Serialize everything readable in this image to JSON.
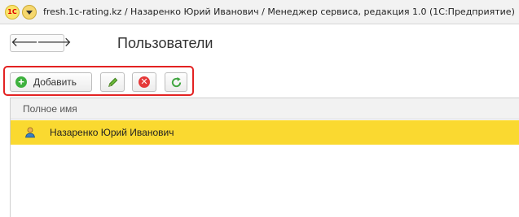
{
  "window": {
    "title": "fresh.1c-rating.kz / Назаренко Юрий Иванович / Менеджер сервиса, редакция 1.0  (1С:Предприятие)",
    "logo_text": "1С"
  },
  "navigation": {
    "back_glyph": "🡐",
    "forward_glyph": "🡒"
  },
  "page": {
    "title": "Пользователи"
  },
  "toolbar": {
    "add_label": "Добавить",
    "add_icon_glyph": "+",
    "delete_icon_glyph": "✕",
    "highlight_color": "#e32222"
  },
  "icons": {
    "add": "plus-circle-icon",
    "edit": "pencil-icon",
    "delete": "delete-circle-icon",
    "refresh": "refresh-icon",
    "user": "user-icon"
  },
  "list": {
    "columns": [
      "Полное имя"
    ],
    "rows": [
      {
        "full_name": "Назаренко Юрий Иванович",
        "selected": true
      }
    ],
    "selected_row_color": "#fad930"
  }
}
